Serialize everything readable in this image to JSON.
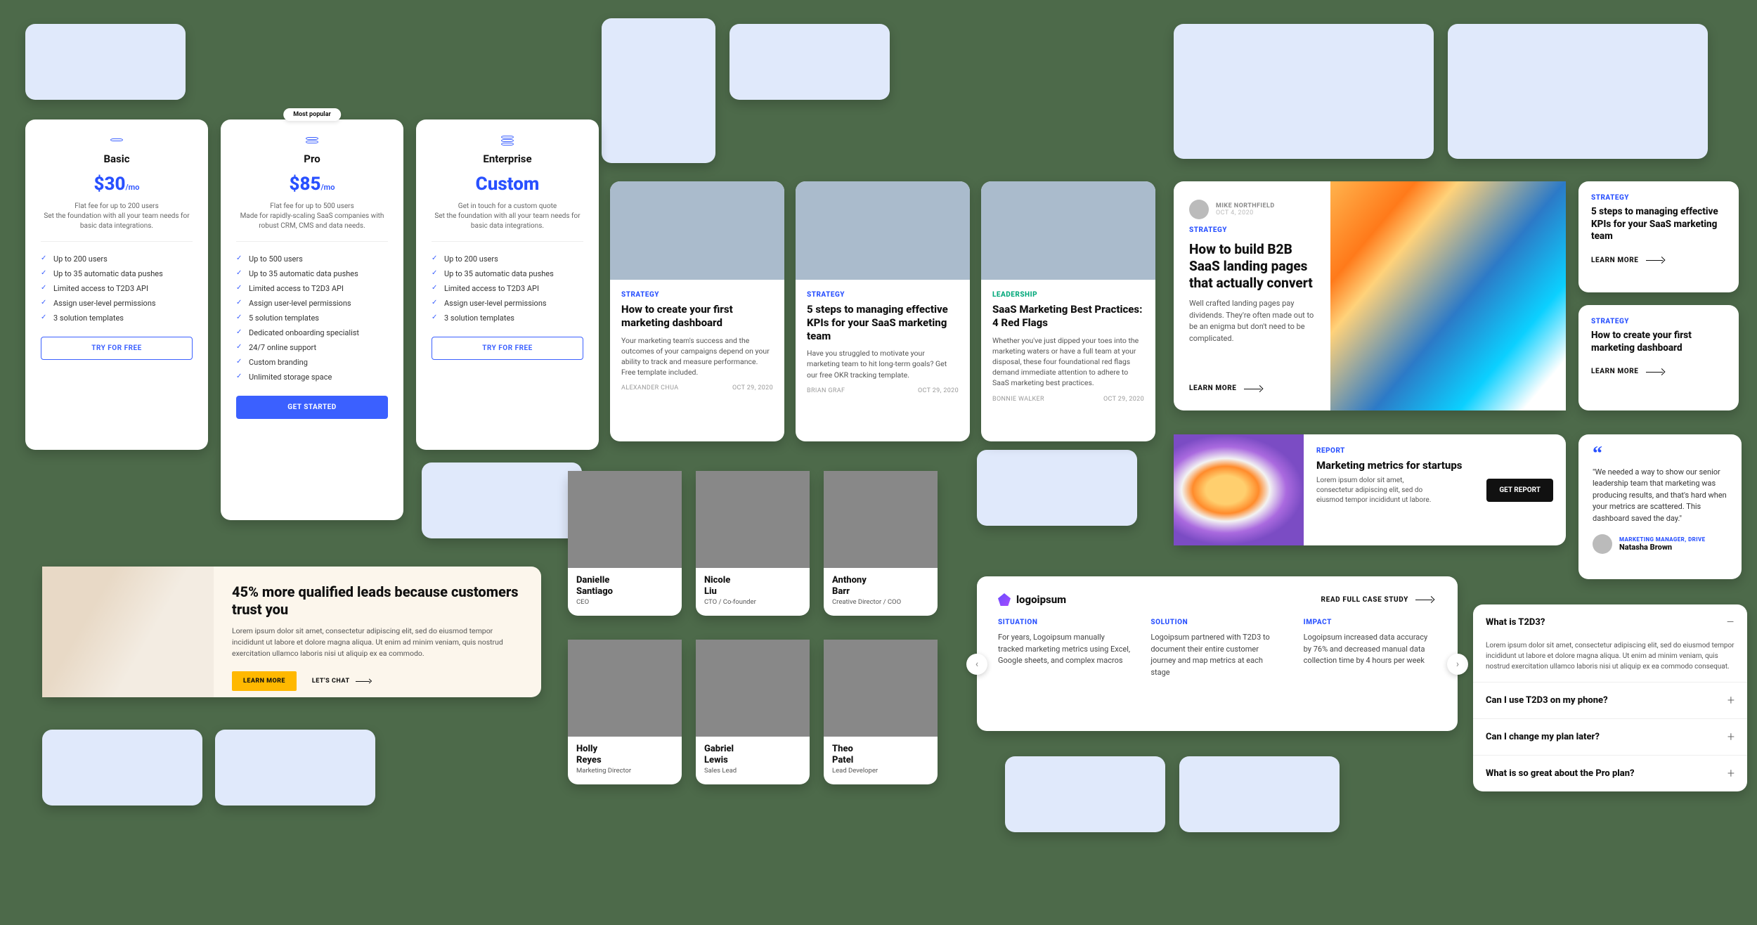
{
  "pricing": {
    "popular_badge": "Most popular",
    "tiers": [
      {
        "name": "Basic",
        "price": "$30",
        "per": "/mo",
        "desc_line1": "Flat fee for up to 200 users",
        "desc_line2": "Set the foundation with all your team needs for basic data integrations.",
        "features": [
          "Up to 200 users",
          "Up to 35 automatic data pushes",
          "Limited access to T2D3 API",
          "Assign user-level permissions",
          "3 solution templates"
        ],
        "cta": "TRY FOR FREE",
        "cta_style": "outline"
      },
      {
        "name": "Pro",
        "price": "$85",
        "per": "/mo",
        "desc_line1": "Flat fee for up to 500 users",
        "desc_line2": "Made for rapidly-scaling SaaS companies with robust CRM, CMS and data needs.",
        "features": [
          "Up to 500 users",
          "Up to 35 automatic data pushes",
          "Limited access to T2D3 API",
          "Assign user-level permissions",
          "5 solution templates",
          "Dedicated onboarding specialist",
          "24/7 online support",
          "Custom branding",
          "Unlimited storage space"
        ],
        "cta": "GET STARTED",
        "cta_style": "solid"
      },
      {
        "name": "Enterprise",
        "price": "Custom",
        "per": "",
        "desc_line1": "Get in touch for a custom quote",
        "desc_line2": "Set the foundation with all your team needs for basic data integrations.",
        "features": [
          "Up to 200 users",
          "Up to 35 automatic data pushes",
          "Limited access to T2D3 API",
          "Assign user-level permissions",
          "3 solution templates"
        ],
        "cta": "TRY FOR FREE",
        "cta_style": "outline"
      }
    ]
  },
  "articles": [
    {
      "category": "STRATEGY",
      "cat_class": "",
      "title": "How to create your first marketing dashboard",
      "excerpt": "Your marketing team's success and the outcomes of your campaigns depend on your ability to track and measure performance. Free template included.",
      "author": "ALEXANDER CHUA",
      "date": "OCT 29, 2020"
    },
    {
      "category": "STRATEGY",
      "cat_class": "",
      "title": "5 steps to managing effective KPIs for your SaaS marketing team",
      "excerpt": "Have you struggled to motivate your marketing team to hit long-term goals? Get our free OKR tracking template.",
      "author": "BRIAN GRAF",
      "date": "OCT 29, 2020"
    },
    {
      "category": "LEADERSHIP",
      "cat_class": "green",
      "title": "SaaS Marketing Best Practices: 4 Red Flags",
      "excerpt": "Whether you've just dipped your toes into the marketing waters or have a full team at your disposal, these four foundational red flags demand immediate attention to adhere to SaaS marketing best practices.",
      "author": "BONNIE WALKER",
      "date": "OCT 29, 2020"
    }
  ],
  "featured": {
    "author": "MIKE NORTHFIELD",
    "date": "OCT 4, 2020",
    "category": "STRATEGY",
    "title": "How to build B2B SaaS landing pages that actually convert",
    "excerpt": "Well crafted landing pages pay dividends. They're often made out to be an enigma but don't need to be complicated.",
    "learn_more": "LEARN MORE"
  },
  "mini_features": [
    {
      "category": "STRATEGY",
      "title": "5 steps to managing effective KPIs for your SaaS marketing team",
      "learn_more": "LEARN MORE"
    },
    {
      "category": "STRATEGY",
      "title": "How to create your first marketing dashboard",
      "learn_more": "LEARN MORE"
    }
  ],
  "report": {
    "category": "REPORT",
    "title": "Marketing metrics for startups",
    "excerpt": "Lorem ipsum dolor sit amet, consectetur adipiscing elit, sed do eiusmod tempor incididunt ut labore.",
    "cta": "GET REPORT"
  },
  "quote": {
    "text": "\"We needed a way to show our senior leadership team that marketing was producing results, and that's hard when your metrics are scattered. This dashboard saved the day.\"",
    "role": "MARKETING MANAGER, DRIVE",
    "name": "Natasha Brown"
  },
  "cta": {
    "title": "45% more qualified leads because customers trust you",
    "body": "Lorem ipsum dolor sit amet, consectetur adipiscing elit, sed do eiusmod tempor incididunt ut labore et dolore magna aliqua. Ut enim ad minim veniam, quis nostrud exercitation ullamco laboris nisi ut aliquip ex ea commodo.",
    "primary": "LEARN MORE",
    "secondary": "LET'S CHAT"
  },
  "team": [
    {
      "first": "Danielle",
      "last": "Santiago",
      "role": "CEO"
    },
    {
      "first": "Nicole",
      "last": "Liu",
      "role": "CTO / Co-founder"
    },
    {
      "first": "Anthony",
      "last": "Barr",
      "role": "Creative Director / COO"
    },
    {
      "first": "Holly",
      "last": "Reyes",
      "role": "Marketing Director"
    },
    {
      "first": "Gabriel",
      "last": "Lewis",
      "role": "Sales Lead"
    },
    {
      "first": "Theo",
      "last": "Patel",
      "role": "Lead Developer"
    }
  ],
  "case_study": {
    "logo": "logoipsum",
    "read_full": "READ FULL CASE STUDY",
    "cols": [
      {
        "h": "SITUATION",
        "p": "For years, Logoipsum manually tracked marketing metrics using Excel, Google sheets, and complex macros"
      },
      {
        "h": "SOLUTION",
        "p": "Logoipsum partnered with T2D3 to document their entire customer journey and map metrics at each stage"
      },
      {
        "h": "IMPACT",
        "p": "Logoipsum increased data accuracy by 76% and decreased manual data collection time by 4 hours per week"
      }
    ]
  },
  "faq": {
    "items": [
      {
        "q": "What is T2D3?",
        "a": "Lorem ipsum dolor sit amet, consectetur adipiscing elit, sed do eiusmod tempor incididunt ut labore et dolore magna aliqua. Ut enim ad minim veniam, quis nostrud exercitation ullamco laboris nisi ut aliquip ex ea commodo consequat.",
        "open": true
      },
      {
        "q": "Can I use T2D3 on my phone?",
        "a": "",
        "open": false
      },
      {
        "q": "Can I change my plan later?",
        "a": "",
        "open": false
      },
      {
        "q": "What is so great about the Pro plan?",
        "a": "",
        "open": false
      }
    ]
  }
}
